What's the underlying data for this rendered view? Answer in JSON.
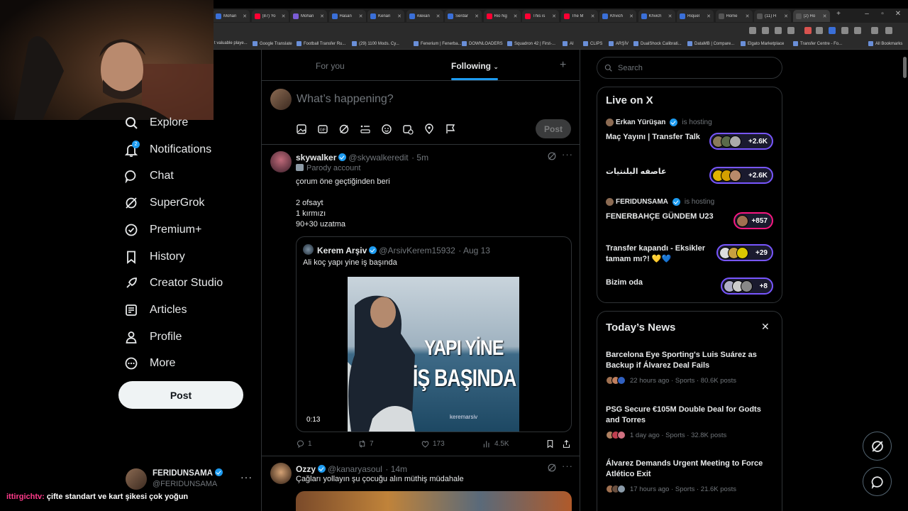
{
  "browser": {
    "tabs": [
      {
        "label": "Mohan",
        "icon_color": "#3a6fd8"
      },
      {
        "label": "(87) Yo",
        "icon_color": "#ff0033"
      },
      {
        "label": "Mohan",
        "icon_color": "#7b5cd6"
      },
      {
        "label": "Hasan",
        "icon_color": "#3a6fd8"
      },
      {
        "label": "Kenan",
        "icon_color": "#3a6fd8"
      },
      {
        "label": "Alexan",
        "icon_color": "#3a6fd8"
      },
      {
        "label": "Serdar",
        "icon_color": "#3a6fd8"
      },
      {
        "label": "Rio Ng",
        "icon_color": "#ff0033"
      },
      {
        "label": "This is",
        "icon_color": "#ff0033"
      },
      {
        "label": "The M",
        "icon_color": "#ff0033"
      },
      {
        "label": "Khvich",
        "icon_color": "#3a6fd8"
      },
      {
        "label": "Khvich",
        "icon_color": "#3a6fd8"
      },
      {
        "label": "Riquel",
        "icon_color": "#3a6fd8"
      },
      {
        "label": "Home",
        "icon_color": "#555555"
      },
      {
        "label": "(11) H",
        "icon_color": "#555555"
      },
      {
        "label": "(2) Ho",
        "icon_color": "#555555"
      }
    ],
    "bookmarks": [
      "t valuable playe...",
      "Google Translate",
      "Football Transfer Ru...",
      "(29) 1100 Mods. Cy...",
      "Fenerium | Fenerba...",
      "DOWNLOADERS",
      "Squadron 42 | First-...",
      "AI",
      "CLIPS",
      "ARŞİV",
      "DualShock Calibrati...",
      "DataMB | Compare...",
      "Elgato Marketplace",
      "Transfer Centre - Fo...",
      "All Bookmarks"
    ]
  },
  "nav": {
    "items": [
      {
        "label": "Explore",
        "icon": "search-icon"
      },
      {
        "label": "Notifications",
        "icon": "bell-icon",
        "badge": "2"
      },
      {
        "label": "Chat",
        "icon": "chat-icon"
      },
      {
        "label": "SuperGrok",
        "icon": "grok-icon"
      },
      {
        "label": "Premium+",
        "icon": "verified-badge-icon"
      },
      {
        "label": "History",
        "icon": "bookmark-icon"
      },
      {
        "label": "Creator Studio",
        "icon": "rocket-icon"
      },
      {
        "label": "Articles",
        "icon": "article-icon"
      },
      {
        "label": "Profile",
        "icon": "person-icon"
      },
      {
        "label": "More",
        "icon": "more-circle-icon"
      }
    ],
    "post_label": "Post",
    "account": {
      "name": "FERIDUNSAMA",
      "handle": "@FERIDUNSAMA"
    }
  },
  "chat_overlay": {
    "user": "ittirgichtv:",
    "message": "çifte standart ve kart şikesi çok yoğun"
  },
  "timeline": {
    "tabs": {
      "for_you": "For you",
      "following": "Following"
    },
    "composer": {
      "placeholder": "What’s happening?",
      "post_label": "Post"
    },
    "tweet1": {
      "name": "skywalker",
      "handle": "@skywalkeredit",
      "time": "· 5m",
      "parody": "Parody account",
      "lines": [
        "çorum öne geçtiğinden beri",
        "2 ofsayt",
        "1 kırmızı",
        "90+30 uzatma"
      ],
      "quote": {
        "name": "Kerem Arşiv",
        "handle": "@ArsivKerem15932",
        "time": "· Aug 13",
        "text": "Ali koç yapı yine iş başında",
        "image_caption_1": "YAPI YİNE",
        "image_caption_2": "İŞ BAŞINDA",
        "watermark": "keremarsiv",
        "duration": "0:13"
      },
      "stats": {
        "replies": "1",
        "reposts": "7",
        "likes": "173",
        "views": "4.5K"
      }
    },
    "tweet2": {
      "name": "Ozzy",
      "handle": "@kanaryasoul",
      "time": "· 14m",
      "text": "Çağları yollayın şu çocuğu alın müthiş müdahale"
    }
  },
  "sidebar": {
    "search_placeholder": "Search",
    "live": {
      "title": "Live on X",
      "hosting": "is hosting",
      "host1": "Erkan Yürüşan",
      "space1": "Maç Yayını | Transfer Talk",
      "count1": "+2.6K",
      "space2": "عاصفه البلنتيات",
      "count2": "+2.6K",
      "host2": "FERIDUNSAMA",
      "space3": "FENERBAHÇE GÜNDEM U23",
      "count3": "+857",
      "space4": "Transfer kapandı - Eksikler tamam mı?! 💛💙",
      "count4": "+29",
      "space5": "Bizim oda",
      "count5": "+8"
    },
    "news": {
      "title": "Today’s News",
      "items": [
        {
          "title": "Barcelona Eye Sporting's Luis Suárez as Backup if Álvarez Deal Fails",
          "meta": "22 hours ago · Sports · 80.6K posts"
        },
        {
          "title": "PSG Secure €105M Double Deal for Godts and Torres",
          "meta": "1 day ago · Sports · 32.8K posts"
        },
        {
          "title": "Álvarez Demands Urgent Meeting to Force Atlético Exit",
          "meta": "17 hours ago · Sports · 21.6K posts"
        }
      ]
    }
  },
  "colors": {
    "accent": "#1d9bf0",
    "background": "#000000",
    "border": "#2f3336",
    "muted": "#71767b",
    "live_ring": "#7856ff",
    "live_ring_alt": "#f91880"
  }
}
